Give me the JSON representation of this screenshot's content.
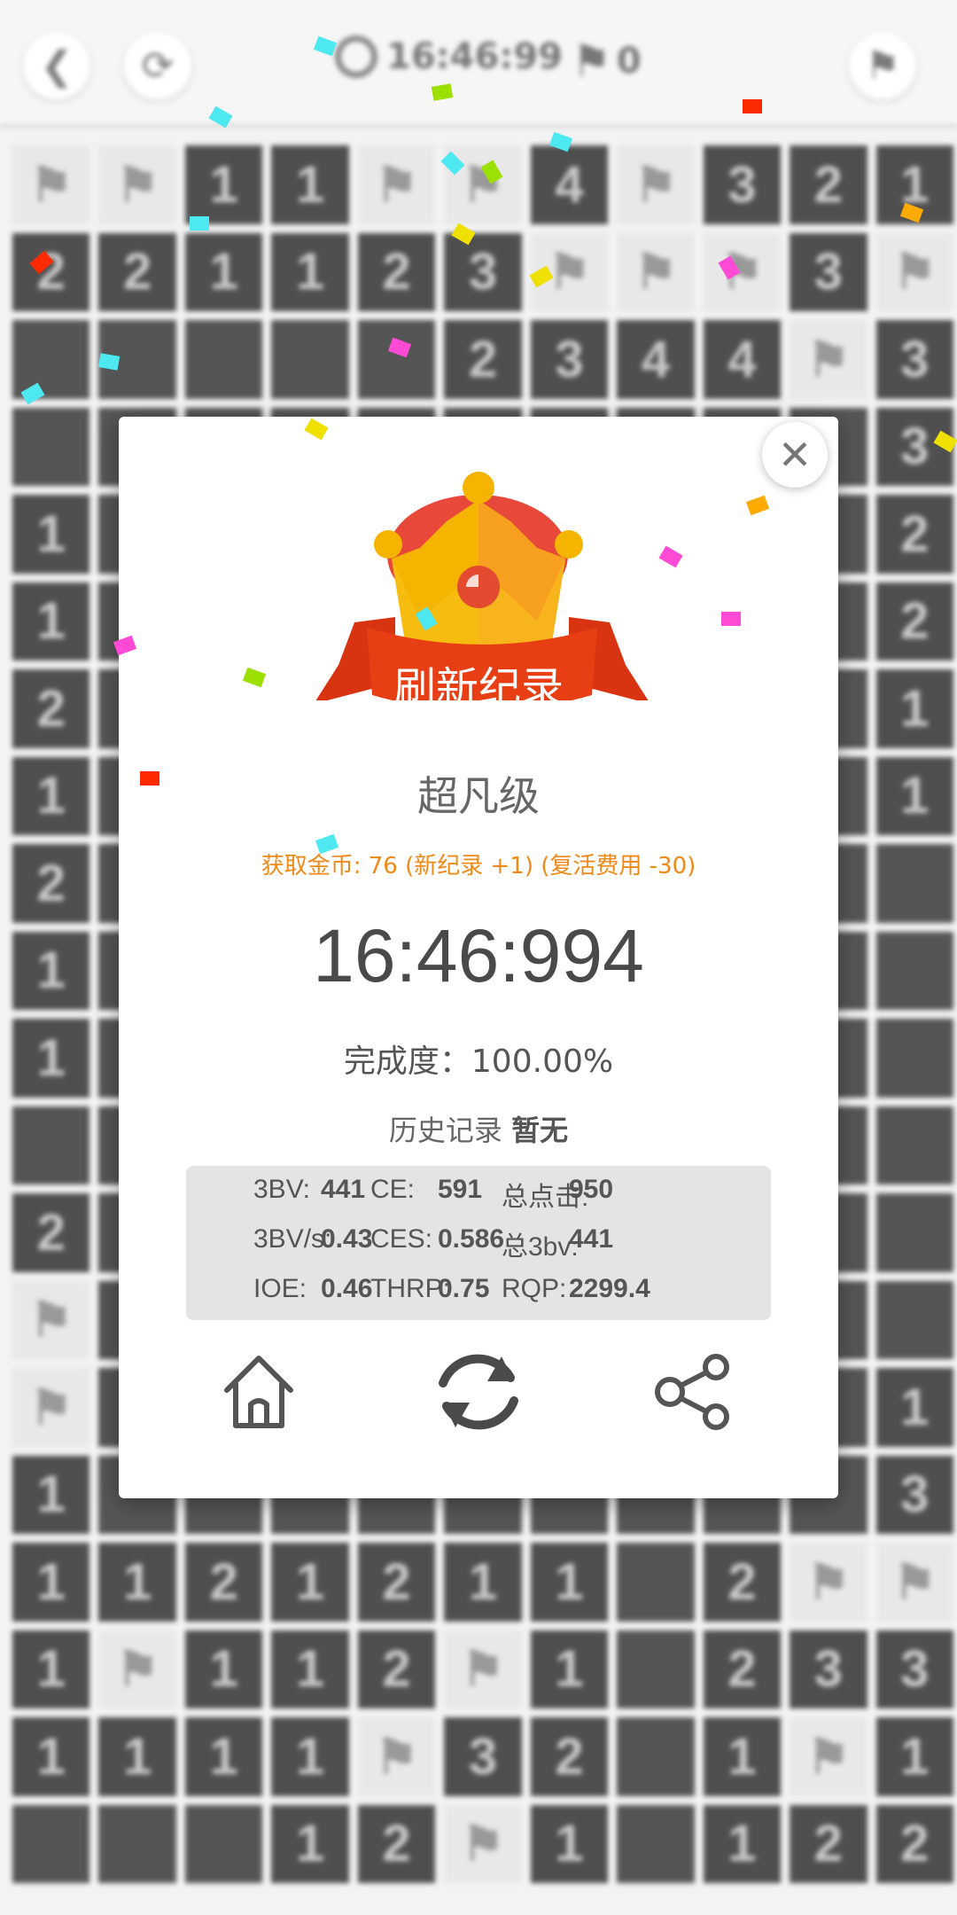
{
  "topbar": {
    "back_icon": "chevron-left-icon",
    "hint_icon": "refresh-hint-icon",
    "timer": "16:46:99",
    "flag_count": "0",
    "play_icon": "flag-icon"
  },
  "board": {
    "rows": [
      [
        "F",
        "F",
        "1",
        "1",
        "F",
        "F",
        "4",
        "F",
        "3",
        "2",
        "1"
      ],
      [
        "2",
        "2",
        "1",
        "1",
        "2",
        "3",
        "F",
        "F",
        "F",
        "3",
        "F"
      ],
      [
        "",
        "",
        "",
        "",
        "",
        "2",
        "3",
        "4",
        "4",
        "F",
        "3"
      ],
      [
        "",
        "",
        "",
        "",
        "",
        "",
        "",
        "",
        "",
        "",
        "3"
      ],
      [
        "1",
        "",
        "",
        "",
        "",
        "",
        "",
        "",
        "",
        "",
        "2"
      ],
      [
        "1",
        "",
        "",
        "",
        "",
        "",
        "",
        "",
        "",
        "",
        "2"
      ],
      [
        "2",
        "",
        "",
        "",
        "",
        "",
        "",
        "",
        "",
        "",
        "1"
      ],
      [
        "1",
        "",
        "",
        "",
        "",
        "",
        "",
        "",
        "",
        "",
        "1"
      ],
      [
        "2",
        "",
        "",
        "",
        "",
        "",
        "",
        "",
        "",
        "",
        ""
      ],
      [
        "1",
        "",
        "",
        "",
        "",
        "",
        "",
        "",
        "",
        "",
        ""
      ],
      [
        "1",
        "",
        "",
        "",
        "",
        "",
        "",
        "",
        "",
        "",
        ""
      ],
      [
        "",
        "",
        "",
        "",
        "",
        "",
        "",
        "",
        "",
        "",
        ""
      ],
      [
        "2",
        "",
        "",
        "",
        "",
        "",
        "",
        "",
        "",
        "",
        ""
      ],
      [
        "F",
        "",
        "",
        "",
        "",
        "",
        "",
        "",
        "",
        "",
        ""
      ],
      [
        "F",
        "",
        "",
        "",
        "",
        "",
        "",
        "",
        "",
        "",
        "1"
      ],
      [
        "1",
        "",
        "",
        "",
        "",
        "",
        "",
        "",
        "",
        "",
        "3"
      ],
      [
        "1",
        "1",
        "2",
        "1",
        "2",
        "1",
        "1",
        "",
        "2",
        "F",
        "F"
      ],
      [
        "1",
        "F",
        "1",
        "1",
        "2",
        "F",
        "1",
        "",
        "2",
        "3",
        "3"
      ],
      [
        "1",
        "1",
        "1",
        "1",
        "F",
        "3",
        "2",
        "",
        "1",
        "F",
        "1"
      ],
      [
        "",
        "",
        "",
        "1",
        "2",
        "F",
        "1",
        "",
        "1",
        "2",
        "2"
      ]
    ]
  },
  "modal": {
    "banner": "刷新纪录",
    "level": "超凡级",
    "coins": "获取金币: 76 (新纪录 +1) (复活费用 -30)",
    "time": "16:46:994",
    "completion": "完成度：100.00%",
    "history_label": "历史记录",
    "history_value": "暂无",
    "stats": [
      [
        {
          "k": "3BV:",
          "v": "441"
        },
        {
          "k": "CE:",
          "v": "591"
        },
        {
          "k": "总点击:",
          "v": "950"
        }
      ],
      [
        {
          "k": "3BV/s:",
          "v": "0.43"
        },
        {
          "k": "CES:",
          "v": "0.586"
        },
        {
          "k": "总3bv:",
          "v": "441"
        }
      ],
      [
        {
          "k": "IOE:",
          "v": "0.46"
        },
        {
          "k": "THRP:",
          "v": "0.75"
        },
        {
          "k": "RQP:",
          "v": "2299.4"
        }
      ]
    ],
    "actions": [
      "home-icon",
      "replay-icon",
      "share-icon"
    ]
  },
  "colors": {
    "crown_gold": "#f5b400",
    "crown_red": "#e8483a",
    "ribbon": "#e63b12",
    "coins_text": "#ef8a18"
  }
}
